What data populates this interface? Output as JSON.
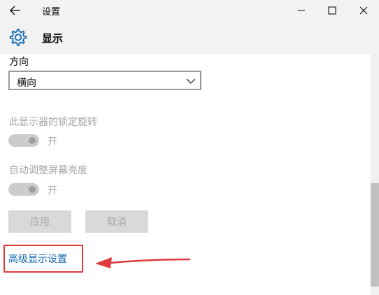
{
  "window": {
    "title": "设置"
  },
  "header": {
    "title": "显示",
    "icon": "gear-icon"
  },
  "orientation": {
    "label": "方向",
    "selected": "横向"
  },
  "lock_rotation": {
    "label": "此显示器的锁定旋转",
    "state_text": "开",
    "enabled": false
  },
  "auto_brightness": {
    "label": "自动调整屏幕亮度",
    "state_text": "开",
    "enabled": false
  },
  "buttons": {
    "apply": "应用",
    "cancel": "取消"
  },
  "advanced_link": "高级显示设置",
  "colors": {
    "accent": "#1067b3",
    "annotation": "#e03a3a",
    "disabled_text": "#a6a6a6"
  }
}
